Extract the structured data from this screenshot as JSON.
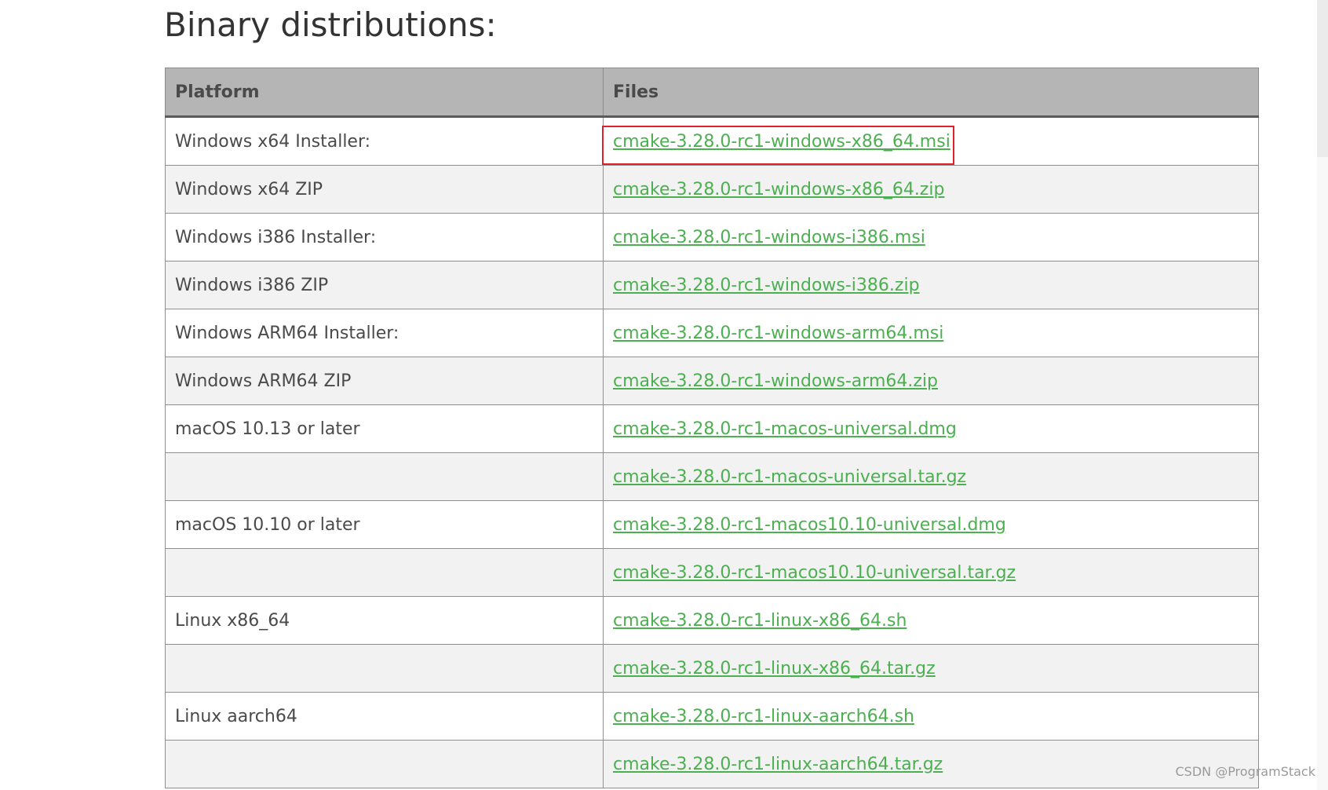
{
  "heading": "Binary distributions:",
  "table": {
    "headers": [
      "Platform",
      "Files"
    ],
    "rows": [
      {
        "platform": "Windows x64 Installer:",
        "file": "cmake-3.28.0-rc1-windows-x86_64.msi"
      },
      {
        "platform": "Windows x64 ZIP",
        "file": "cmake-3.28.0-rc1-windows-x86_64.zip"
      },
      {
        "platform": "Windows i386 Installer:",
        "file": "cmake-3.28.0-rc1-windows-i386.msi"
      },
      {
        "platform": "Windows i386 ZIP",
        "file": "cmake-3.28.0-rc1-windows-i386.zip"
      },
      {
        "platform": "Windows ARM64 Installer:",
        "file": "cmake-3.28.0-rc1-windows-arm64.msi"
      },
      {
        "platform": "Windows ARM64 ZIP",
        "file": "cmake-3.28.0-rc1-windows-arm64.zip"
      },
      {
        "platform": "macOS 10.13 or later",
        "file": "cmake-3.28.0-rc1-macos-universal.dmg"
      },
      {
        "platform": "",
        "file": "cmake-3.28.0-rc1-macos-universal.tar.gz"
      },
      {
        "platform": "macOS 10.10 or later",
        "file": "cmake-3.28.0-rc1-macos10.10-universal.dmg"
      },
      {
        "platform": "",
        "file": "cmake-3.28.0-rc1-macos10.10-universal.tar.gz"
      },
      {
        "platform": "Linux x86_64",
        "file": "cmake-3.28.0-rc1-linux-x86_64.sh"
      },
      {
        "platform": "",
        "file": "cmake-3.28.0-rc1-linux-x86_64.tar.gz"
      },
      {
        "platform": "Linux aarch64",
        "file": "cmake-3.28.0-rc1-linux-aarch64.sh"
      },
      {
        "platform": "",
        "file": "cmake-3.28.0-rc1-linux-aarch64.tar.gz"
      }
    ]
  },
  "highlight": {
    "color": "#e0202a"
  },
  "colors": {
    "link": "#4caf50",
    "header_bg": "#b5b5b5"
  },
  "watermark": "CSDN @ProgramStack"
}
